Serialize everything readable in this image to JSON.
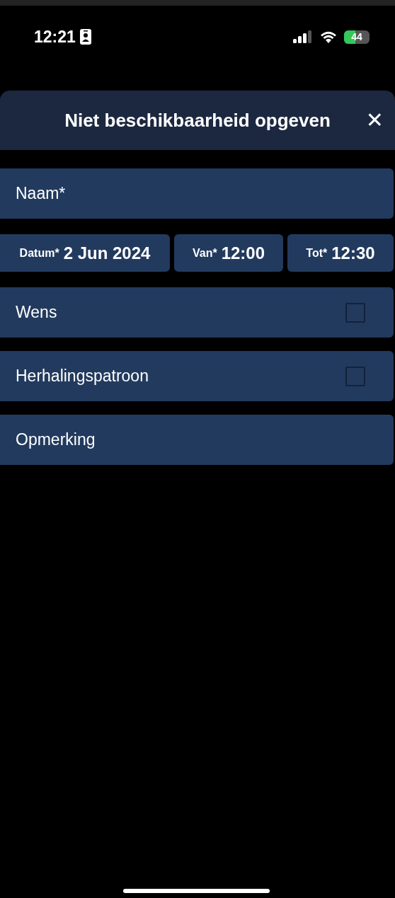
{
  "status_bar": {
    "time": "12:21",
    "battery": "44"
  },
  "dialog": {
    "title": "Niet beschikbaarheid opgeven",
    "close": "✕"
  },
  "name_field": {
    "placeholder": "Naam*"
  },
  "date_time": [
    {
      "label": "Datum*",
      "value": "2 Jun 2024"
    },
    {
      "label": "Van*",
      "value": "12:00"
    },
    {
      "label": "Tot*",
      "value": "12:30"
    }
  ],
  "options": [
    {
      "label": "Wens",
      "checked": false
    },
    {
      "label": "Herhalingspatroon",
      "checked": false
    }
  ],
  "remark_field": {
    "placeholder": "Opmerking"
  }
}
